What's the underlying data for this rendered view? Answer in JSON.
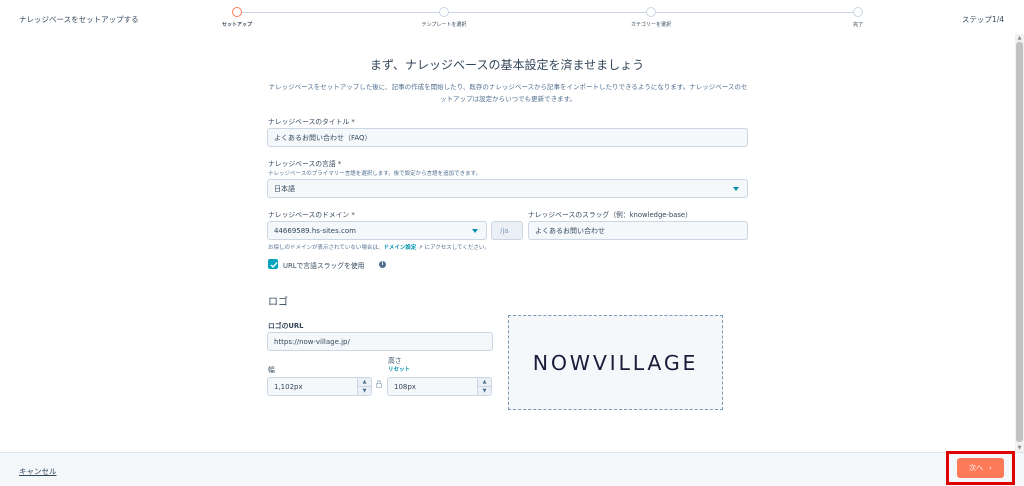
{
  "header": {
    "title": "ナレッジベースをセットアップする",
    "step_count": "ステップ1/4",
    "steps": [
      {
        "label": "セットアップ",
        "active": true
      },
      {
        "label": "テンプレートを選択",
        "active": false
      },
      {
        "label": "カテゴリーを選択",
        "active": false
      },
      {
        "label": "完了",
        "active": false
      }
    ]
  },
  "main": {
    "heading": "まず、ナレッジベースの基本設定を済ませましょう",
    "intro": "ナレッジベースをセットアップした後に、記事の作成を開始したり、既存のナレッジベースから記事をインポートしたりできるようになります。ナレッジベースのセットアップは設定からいつでも更新できます。",
    "title_field": {
      "label": "ナレッジベースのタイトル *",
      "value": "よくあるお問い合わせ（FAQ）"
    },
    "language_field": {
      "label": "ナレッジベースの言語 *",
      "help": "ナレッジベースのプライマリー言語を選択します。後で設定から言語を追加できます。",
      "value": "日本語"
    },
    "domain_field": {
      "label": "ナレッジベースのドメイン *",
      "value": "44669589.hs-sites.com",
      "suffix": "/ja",
      "help_prefix": "お探しのドメインが表示されていない場合は、",
      "help_link": "ドメイン設定",
      "help_suffix": " にアクセスしてください。"
    },
    "slug_field": {
      "label": "ナレッジベースのスラッグ（例：knowledge-base）",
      "value": "よくあるお問い合わせ"
    },
    "url_checkbox": {
      "label": "URLで言語スラッグを使用",
      "checked": true
    }
  },
  "logo": {
    "section_title": "ロゴ",
    "url_label": "ロゴのURL",
    "url_value": "https://now-village.jp/",
    "width_label": "幅",
    "width_value": "1,102px",
    "height_label": "高さ",
    "reset_label": "リセット",
    "height_value": "108px",
    "preview_text": "NOWVILLAGE"
  },
  "footer": {
    "cancel_label": "キャンセル",
    "next_label": "次へ"
  },
  "colors": {
    "accent": "#ff7a59",
    "link": "#0091ae",
    "highlight": "#e00000",
    "checkbox": "#00a4bd"
  }
}
